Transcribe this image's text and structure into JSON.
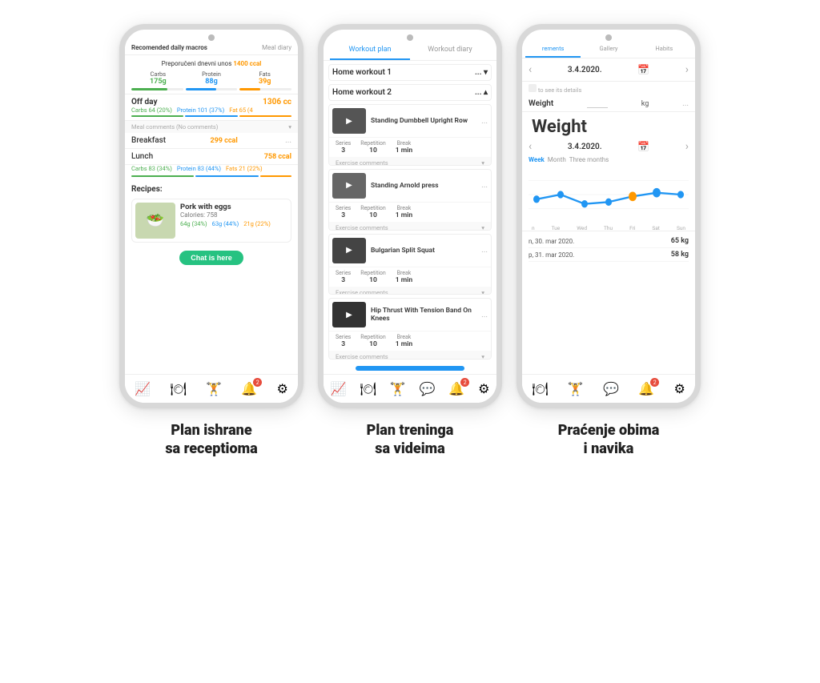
{
  "page": {
    "bg": "#fff"
  },
  "phone1": {
    "tabs": [
      "Recomended daily macros",
      "Meal diary"
    ],
    "dailyTitle": "Preporučeni dnevni unos",
    "dailyCalories": "1400 ccal",
    "macros": {
      "carbs": {
        "label": "Carbs",
        "value": "175g"
      },
      "protein": {
        "label": "Protein",
        "value": "88g"
      },
      "fats": {
        "label": "Fats",
        "value": "39g"
      }
    },
    "offDay": {
      "label": "Off day",
      "calories": "1306 cc",
      "carbs": "Carbs\n64 (20%)",
      "protein": "Protein\n101 (37%)",
      "fat": "Fat\n65 (4"
    },
    "mealComments": "Meal comments (No comments)",
    "breakfast": {
      "label": "Breakfast",
      "calories": "299 ccal",
      "dots": "..."
    },
    "lunch": {
      "label": "Lunch",
      "calories": "758 ccal",
      "carbs": "Carbs\n83 (34%)",
      "protein": "Protein\n83 (44%)",
      "fats": "Fats\n21 (22%"
    },
    "recipesLabel": "Recipes:",
    "recipe": {
      "name": "Pork with eggs",
      "calories": "Calories: 758",
      "carbs": "64g (34%)",
      "protein": "63g (44%)",
      "fats": "21g (22%)"
    },
    "chatBtn": "Chat is here",
    "nav": [
      "📈",
      "🍽",
      "🏋",
      "🔔",
      "⚙"
    ]
  },
  "phone2": {
    "tabs": [
      "Workout plan",
      "Workout diary"
    ],
    "workoutGroups": [
      {
        "name": "Home workout 1",
        "collapsed": true
      },
      {
        "name": "Home workout 2",
        "collapsed": false
      }
    ],
    "exercises": [
      {
        "name": "Standing Dumbbell Upright Row",
        "series": "3",
        "repetition": "10",
        "break": "1 min"
      },
      {
        "name": "Standing Arnold press",
        "series": "3",
        "repetition": "10",
        "break": "1 min"
      },
      {
        "name": "Bulgarian Split Squat",
        "series": "3",
        "repetition": "10",
        "break": "1 min"
      },
      {
        "name": "Hip Thrust With Tension Band On Knees",
        "series": "3",
        "repetition": "10",
        "break": "1 min"
      }
    ],
    "exerciseComments": "Exercise comments",
    "statsLabels": {
      "series": "Series",
      "rep": "Repetition",
      "break": "Break"
    },
    "nav": [
      "📈",
      "🍽",
      "🏋",
      "💬",
      "🔔",
      "⚙"
    ]
  },
  "phone3": {
    "tabs": [
      "rements",
      "Gallery",
      "Habits"
    ],
    "date1": "3.4.2020.",
    "seeDetails": "to see its details",
    "weightLabel": "Weight",
    "weightUnit": "kg",
    "chartTitle": "Weight",
    "date2": "3.4.2020.",
    "periods": [
      "Week",
      "Month",
      "Three months"
    ],
    "xLabels": [
      "n",
      "Tue",
      "Wed",
      "Thu",
      "Fri",
      "Sat",
      "Sun"
    ],
    "dataPoints": [
      63,
      63.5,
      62,
      62,
      62.5,
      63,
      63
    ],
    "logs": [
      {
        "date": "n, 30. mar 2020.",
        "value": "65 kg"
      },
      {
        "date": "p, 31. mar 2020.",
        "value": "58 kg"
      }
    ],
    "nav": [
      "🍽",
      "🏋",
      "💬",
      "🔔",
      "⚙"
    ]
  },
  "captions": [
    {
      "line1": "Plan ishrane",
      "line2": "sa receptioma"
    },
    {
      "line1": "Plan treninga",
      "line2": "sa videima"
    },
    {
      "line1": "Praćenje obima",
      "line2": "i navika"
    }
  ]
}
